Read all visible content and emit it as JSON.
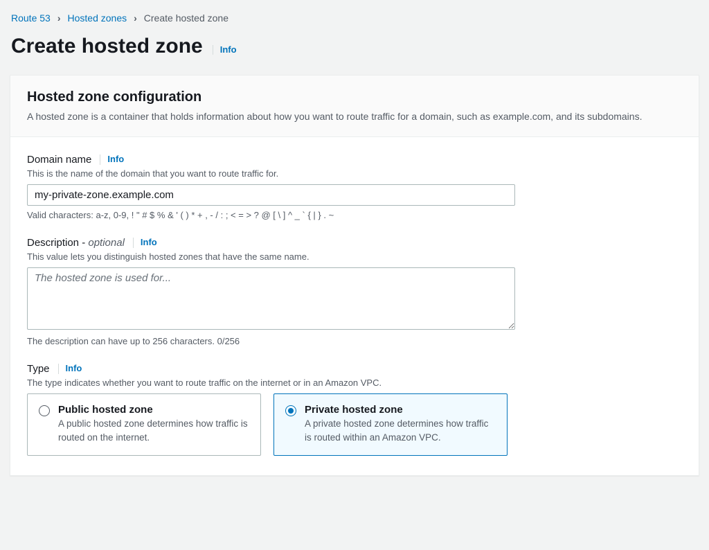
{
  "breadcrumb": {
    "items": [
      "Route 53",
      "Hosted zones",
      "Create hosted zone"
    ]
  },
  "page": {
    "title": "Create hosted zone",
    "info": "Info"
  },
  "panel": {
    "header_title": "Hosted zone configuration",
    "header_desc": "A hosted zone is a container that holds information about how you want to route traffic for a domain, such as example.com, and its subdomains."
  },
  "domain": {
    "label": "Domain name",
    "info": "Info",
    "desc": "This is the name of the domain that you want to route traffic for.",
    "value": "my-private-zone.example.com",
    "hint": "Valid characters: a-z, 0-9, ! \" # $ % & ' ( ) * + , - / : ; < = > ? @ [ \\ ] ^ _ ` { | } . ~"
  },
  "description": {
    "label_main": "Description - ",
    "label_optional": "optional",
    "info": "Info",
    "desc": "This value lets you distinguish hosted zones that have the same name.",
    "placeholder": "The hosted zone is used for...",
    "value": "",
    "hint": "The description can have up to 256 characters. 0/256"
  },
  "type": {
    "label": "Type",
    "info": "Info",
    "desc": "The type indicates whether you want to route traffic on the internet or in an Amazon VPC.",
    "options": [
      {
        "title": "Public hosted zone",
        "desc": "A public hosted zone determines how traffic is routed on the internet."
      },
      {
        "title": "Private hosted zone",
        "desc": "A private hosted zone determines how traffic is routed within an Amazon VPC."
      }
    ],
    "selected": 1
  }
}
